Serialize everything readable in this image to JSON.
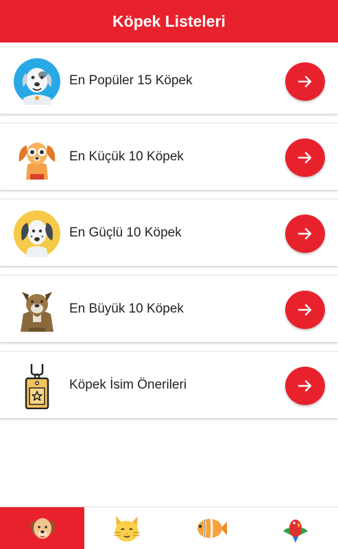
{
  "header": {
    "title": "Köpek Listeleri"
  },
  "colors": {
    "accent": "#e8222d"
  },
  "lists": [
    {
      "label": "En Popüler 15 Köpek",
      "icon": "white-dog-icon"
    },
    {
      "label": "En Küçük 10 Köpek",
      "icon": "orange-puppy-icon"
    },
    {
      "label": "En Güçlü 10 Köpek",
      "icon": "spotted-dog-icon"
    },
    {
      "label": "En Büyük 10 Köpek",
      "icon": "brown-dog-icon"
    },
    {
      "label": "Köpek İsim Önerileri",
      "icon": "dog-tag-icon"
    }
  ],
  "tabs": [
    {
      "name": "dog",
      "icon": "dog-face-icon",
      "active": true
    },
    {
      "name": "cat",
      "icon": "cat-face-icon",
      "active": false
    },
    {
      "name": "fish",
      "icon": "fish-icon",
      "active": false
    },
    {
      "name": "bird",
      "icon": "parrot-icon",
      "active": false
    }
  ]
}
